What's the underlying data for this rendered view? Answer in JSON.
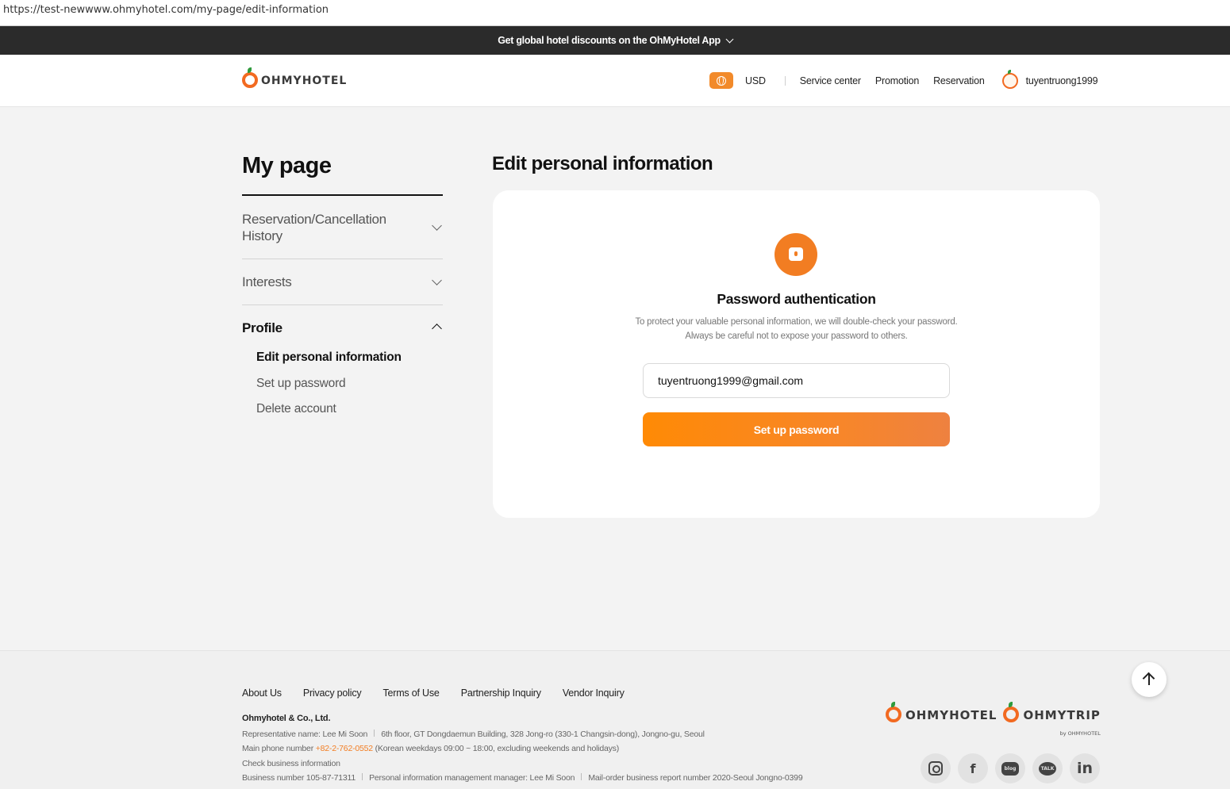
{
  "browser": {
    "url": "https://test-newwww.ohmyhotel.com/my-page/edit-information"
  },
  "promo": {
    "text": "Get global hotel discounts on the OhMyHotel App"
  },
  "header": {
    "logo_text": "OHMYHOTEL",
    "currency": "USD",
    "links": [
      "Service center",
      "Promotion",
      "Reservation"
    ],
    "username": "tuyentruong1999"
  },
  "sidebar": {
    "title": "My page",
    "sections": [
      {
        "label": "Reservation/Cancellation History",
        "expanded": false
      },
      {
        "label": "Interests",
        "expanded": false
      },
      {
        "label": "Profile",
        "expanded": true
      }
    ],
    "profile_items": [
      "Edit personal information",
      "Set up password",
      "Delete account"
    ],
    "active_item": "Edit personal information"
  },
  "content": {
    "title": "Edit personal information",
    "auth_title": "Password authentication",
    "auth_desc_1": "To protect your valuable personal information, we will double-check your password.",
    "auth_desc_2": "Always be careful not to expose your password to others.",
    "email_value": "tuyentruong1999@gmail.com",
    "button_label": "Set up password"
  },
  "footer": {
    "links": [
      "About Us",
      "Privacy policy",
      "Terms of Use",
      "Partnership Inquiry",
      "Vendor Inquiry"
    ],
    "company": "Ohmyhotel & Co., Ltd.",
    "rep_name": "Representative name: Lee Mi Soon",
    "address": "6th floor, GT Dongdaemun Building, 328 Jong-ro (330-1 Changsin-dong), Jongno-gu, Seoul",
    "phone_label": "Main phone number ",
    "phone": "+82-2-762-0552",
    "phone_hours": " (Korean weekdays 09:00 ~ 18:00, excluding weekends and holidays)",
    "check_business": "Check business information",
    "business_number": "Business number 105-87-71311",
    "privacy_manager": "Personal information management manager: Lee Mi Soon",
    "mail_order": "Mail-order business report number 2020-Seoul Jongno-0399",
    "logo1": "OHMYHOTEL",
    "logo2": "OHMYTRIP",
    "logo2_by": "by OHMYHOTEL",
    "social": {
      "blog": "blog",
      "talk": "TALK",
      "facebook": "f",
      "linkedin": "in"
    }
  },
  "colors": {
    "brand_orange": "#f27d22",
    "banner_dark": "#2b2b2b",
    "background": "#f3f3f3"
  }
}
